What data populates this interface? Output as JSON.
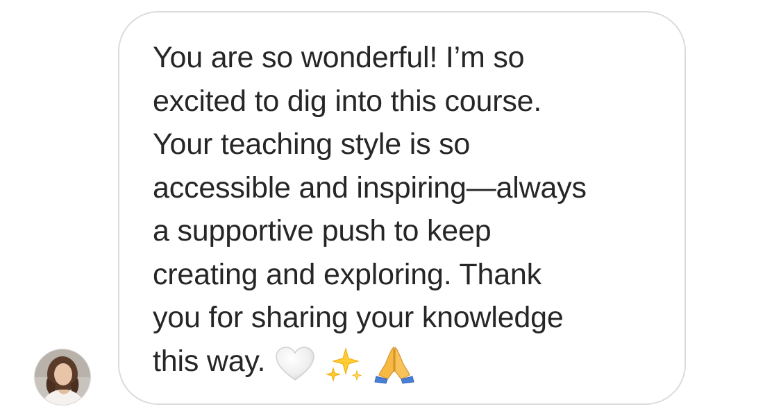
{
  "conversation": {
    "sender": {
      "avatar_icon": "profile-photo-avatar"
    },
    "message": {
      "lines": [
        "You are so wonderful! I’m so",
        "excited to dig into this course.",
        "Your teaching style is so",
        "accessible and inspiring—always",
        "a supportive push to keep",
        "creating and exploring. Thank",
        "you for sharing your knowledge",
        "this way."
      ],
      "emojis": [
        "🤍",
        "✨",
        "🙏"
      ],
      "emoji_icons": [
        "white-heart-icon",
        "sparkles-icon",
        "folded-hands-icon"
      ]
    }
  },
  "colors": {
    "text": "#262626",
    "bubble_border": "#dbdbdb",
    "background": "#ffffff",
    "sparkle": "#ffcc33",
    "hands": "#f5b944",
    "sleeve": "#4a7fd6"
  }
}
